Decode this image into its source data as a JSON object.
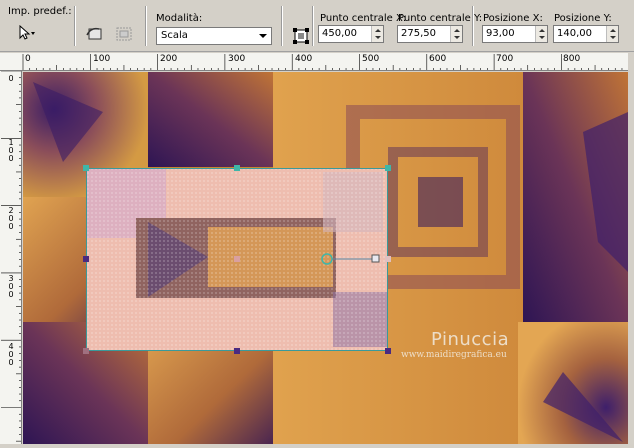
{
  "toolbar": {
    "preset_label": "Imp. predef.:",
    "mode_label": "Modalità:",
    "mode_value": "Scala",
    "center_x_label": "Punto centrale X:",
    "center_x_value": "450,00",
    "center_y_label": "Punto centrale Y:",
    "center_y_value": "275,50",
    "pos_x_label": "Posizione X:",
    "pos_x_value": "93,00",
    "pos_y_label": "Posizione Y:",
    "pos_y_value": "140,00"
  },
  "ruler_top": {
    "labels": [
      "0",
      "100",
      "200",
      "300",
      "400",
      "500",
      "600",
      "700",
      "800"
    ]
  },
  "ruler_left": {
    "labels": [
      "0",
      "1 0 0",
      "2 0 0",
      "3 0 0",
      "4 0 0"
    ]
  },
  "watermark": {
    "name": "Pinuccia",
    "url": "www.maidiregrafica.eu"
  },
  "colors": {
    "accent_handle": "#3fb6a8",
    "selection_border": "#3a9a9a",
    "purple": "#3e1f6b",
    "gold": "#d4953a"
  }
}
